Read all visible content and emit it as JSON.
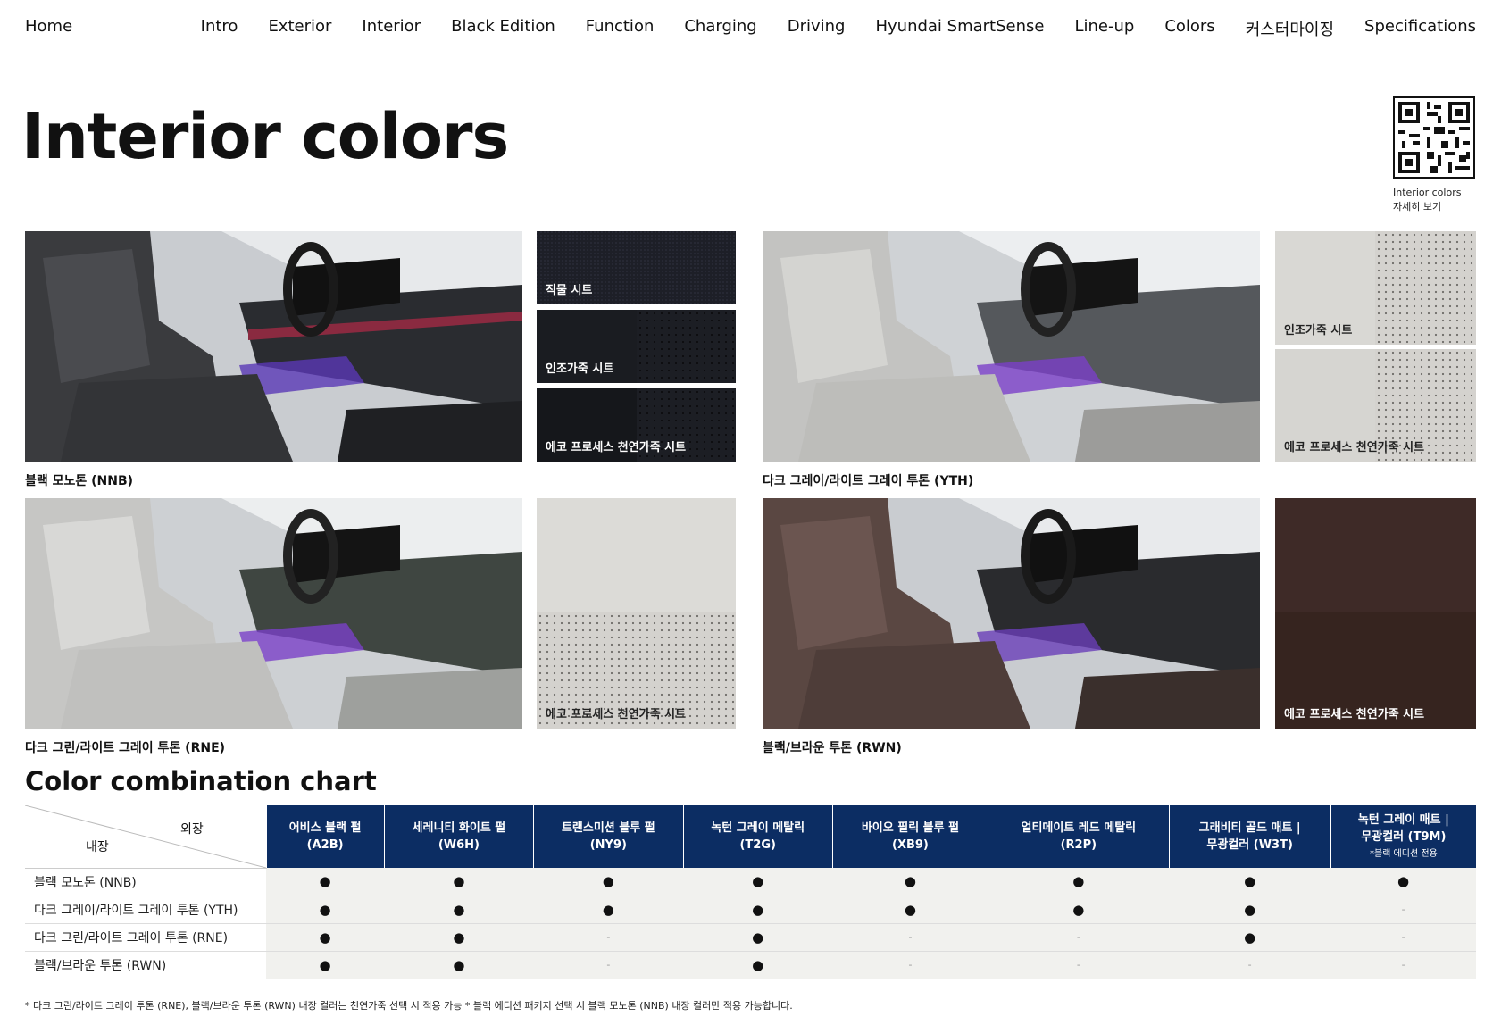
{
  "nav": {
    "home": "Home",
    "items": [
      "Intro",
      "Exterior",
      "Interior",
      "Black Edition",
      "Function",
      "Charging",
      "Driving",
      "Hyundai SmartSense",
      "Line-up",
      "Colors",
      "커스터마이징",
      "Specifications"
    ]
  },
  "page_title": "Interior colors",
  "qr": {
    "caption_line1": "Interior colors",
    "caption_line2": "자세히 보기"
  },
  "interiors": [
    {
      "caption": "블랙 모노톤 (NNB)",
      "swatches": [
        "직물 시트",
        "인조가죽 시트",
        "에코 프로세스 천연가죽 시트"
      ]
    },
    {
      "caption": "다크 그레이/라이트 그레이 투톤 (YTH)",
      "swatches": [
        "인조가죽 시트",
        "에코 프로세스 천연가죽 시트"
      ]
    },
    {
      "caption": "다크 그린/라이트 그레이 투톤 (RNE)",
      "swatches": [
        "에코 프로세스 천연가죽 시트"
      ]
    },
    {
      "caption": "블랙/브라운 투톤 (RWN)",
      "swatches": [
        "에코 프로세스 천연가죽 시트"
      ]
    }
  ],
  "chart_title": "Color combination chart",
  "table": {
    "corner_exterior": "외장",
    "corner_interior": "내장",
    "columns": [
      {
        "name": "어비스 블랙 펄",
        "code": "(A2B)"
      },
      {
        "name": "세레니티 화이트 펄",
        "code": "(W6H)"
      },
      {
        "name": "트랜스미션 블루 펄",
        "code": "(NY9)"
      },
      {
        "name": "녹턴 그레이 메탈릭",
        "code": "(T2G)"
      },
      {
        "name": "바이오 필릭 블루 펄",
        "code": "(XB9)"
      },
      {
        "name": "얼티메이트 레드 메탈릭",
        "code": "(R2P)"
      },
      {
        "name": "그래비티 골드 매트 |",
        "code": "무광컬러 (W3T)"
      },
      {
        "name": "녹턴 그레이 매트 |",
        "code": "무광컬러 (T9M)",
        "note": "*블랙 에디션 전용"
      }
    ],
    "rows": [
      {
        "label": "블랙 모노톤 (NNB)",
        "cells": [
          "●",
          "●",
          "●",
          "●",
          "●",
          "●",
          "●",
          "●"
        ]
      },
      {
        "label": "다크 그레이/라이트 그레이 투톤 (YTH)",
        "cells": [
          "●",
          "●",
          "●",
          "●",
          "●",
          "●",
          "●",
          "-"
        ]
      },
      {
        "label": "다크 그린/라이트 그레이 투톤 (RNE)",
        "cells": [
          "●",
          "●",
          "-",
          "●",
          "-",
          "-",
          "●",
          "-"
        ]
      },
      {
        "label": "블랙/브라운 투톤 (RWN)",
        "cells": [
          "●",
          "●",
          "-",
          "●",
          "-",
          "-",
          "-",
          "-"
        ]
      }
    ]
  },
  "footnote": "* 다크 그린/라이트 그레이 투톤 (RNE), 블랙/브라운 투톤 (RWN) 내장 컬러는 천연가죽 선택 시 적용 가능  * 블랙 에디션 패키지 선택 시 블랙 모노톤 (NNB) 내장 컬러만 적용 가능합니다.",
  "colors": {
    "header_navy": "#0c2d63",
    "cell_bg": "#f1f1ee"
  }
}
